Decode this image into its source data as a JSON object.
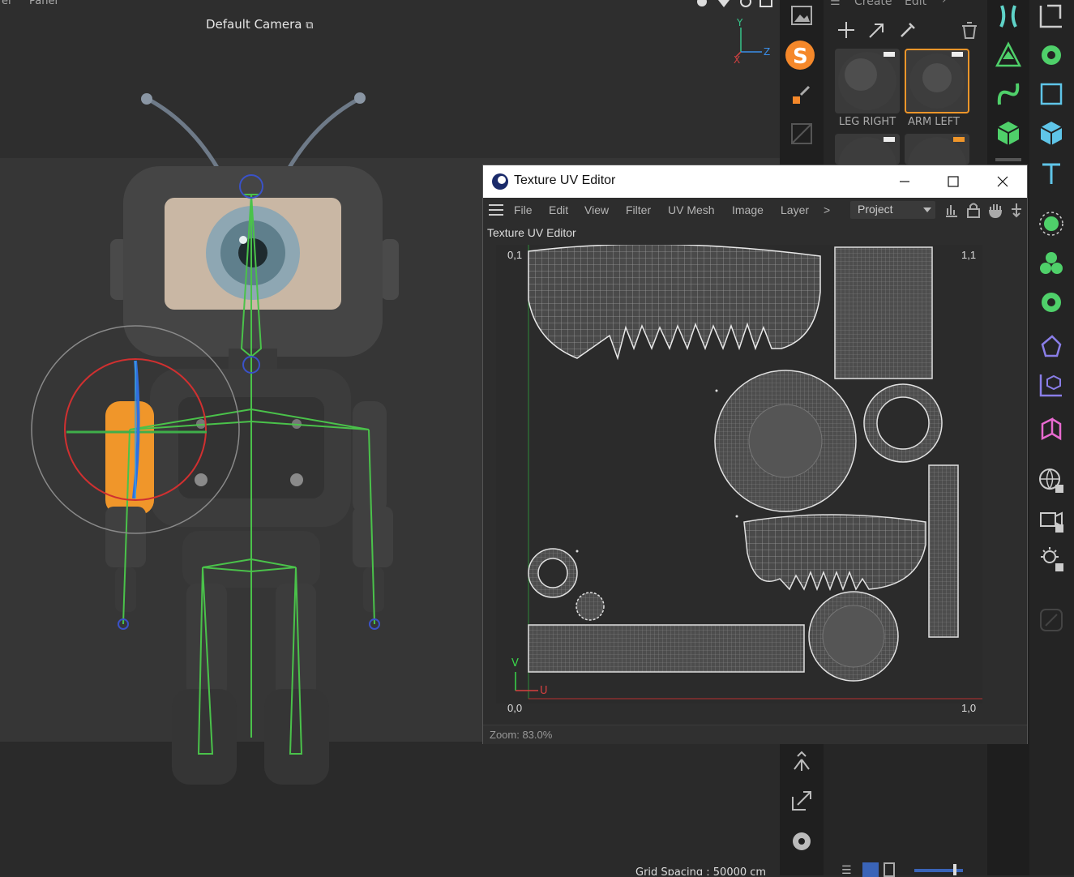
{
  "viewport": {
    "menu": [
      "el",
      "Panel"
    ],
    "camera_label": "Default Camera",
    "grid_spacing": "Grid Spacing : 50000 cm",
    "axis_labels": {
      "y": "Y",
      "x": "X",
      "z": "Z"
    }
  },
  "material_browser": {
    "tabs": [
      "Create",
      "Edit"
    ],
    "materials": [
      {
        "label": "LEG RIGHT"
      },
      {
        "label": "ARM LEFT"
      }
    ]
  },
  "uv_editor": {
    "window_title": "Texture UV Editor",
    "menu": [
      "File",
      "Edit",
      "View",
      "Filter",
      "UV Mesh",
      "Image",
      "Layer"
    ],
    "more": ">",
    "project_select": "Project",
    "panel_title": "Texture UV Editor",
    "corners": {
      "top_left": "0,1",
      "top_right": "1,1",
      "bottom_left": "0,0",
      "bottom_right": "1,0"
    },
    "axes": {
      "u": "U",
      "v": "V"
    },
    "status": "Zoom: 83.0%"
  },
  "colors": {
    "selection_orange": "#f0962a",
    "joint_green": "#4ac24a",
    "accent_teal": "#5fd3c8",
    "uv_axis_red": "#d04040"
  }
}
